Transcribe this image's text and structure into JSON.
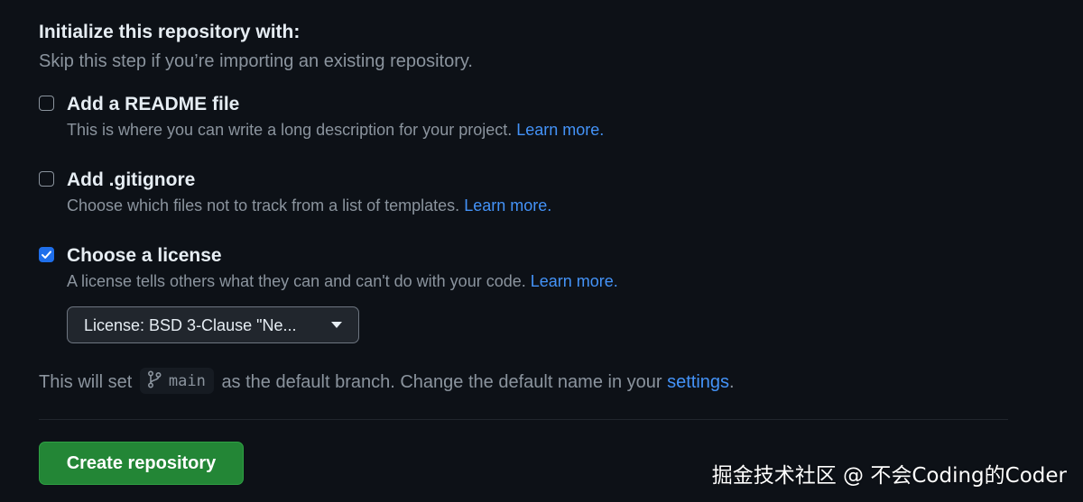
{
  "init": {
    "title": "Initialize this repository with:",
    "subtitle": "Skip this step if you’re importing an existing repository."
  },
  "options": {
    "readme": {
      "label": "Add a README file",
      "desc": "This is where you can write a long description for your project.",
      "link": "Learn more.",
      "checked": false
    },
    "gitignore": {
      "label": "Add .gitignore",
      "desc": "Choose which files not to track from a list of templates.",
      "link": "Learn more.",
      "checked": false
    },
    "license": {
      "label": "Choose a license",
      "desc": "A license tells others what they can and can't do with your code.",
      "link": "Learn more.",
      "checked": true
    }
  },
  "license_select": {
    "value": "License: BSD 3-Clause \"Ne..."
  },
  "branch": {
    "prefix": "This will set",
    "name": "main",
    "middle": "as the default branch. Change the default name in your",
    "link": "settings",
    "suffix": "."
  },
  "create_button": {
    "label": "Create repository"
  },
  "watermark": "掘金技术社区 @ 不会Coding的Coder",
  "colors": {
    "background": "#0d1117",
    "link": "#4493f8",
    "checkbox_checked": "#1f6feb",
    "create_button": "#238636"
  },
  "icons": {
    "branch": "git-branch-icon",
    "caret": "triangle-down-icon",
    "check": "check-icon"
  }
}
